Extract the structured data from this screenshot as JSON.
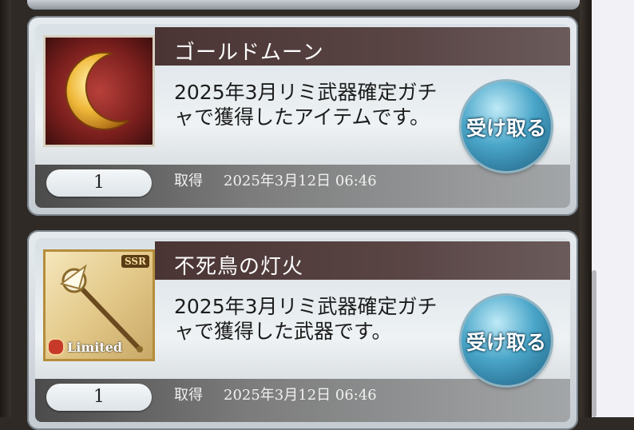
{
  "items": [
    {
      "name": "ゴールドムーン",
      "description": "2025年3月リミ武器確定ガチャで獲得したアイテムです。",
      "quantity": "1",
      "acquired_label": "取得",
      "acquired_date": "2025年3月12日 06:46",
      "receive_label": "受け取る",
      "icon": "gold-moon-icon"
    },
    {
      "name": "不死鳥の灯火",
      "description": "2025年3月リミ武器確定ガチャで獲得した武器です。",
      "quantity": "1",
      "acquired_label": "取得",
      "acquired_date": "2025年3月12日 06:46",
      "receive_label": "受け取る",
      "badge_rarity": "SSR",
      "badge_limited": "Limited",
      "icon": "phoenix-staff-icon"
    }
  ]
}
